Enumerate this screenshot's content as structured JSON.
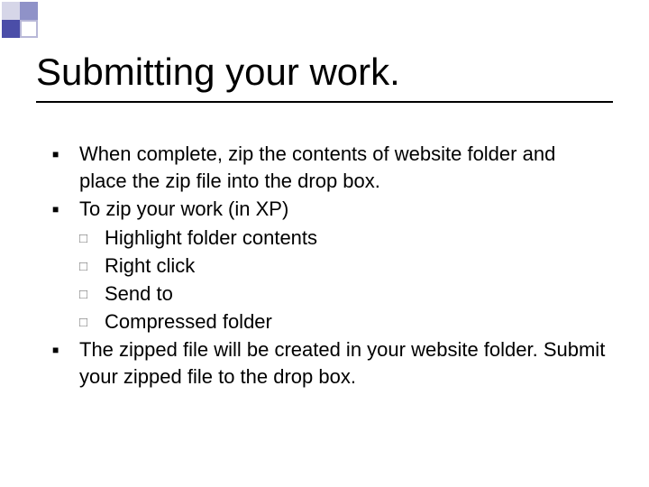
{
  "title": "Submitting your work.",
  "bullets": {
    "b1": "When complete, zip the contents of website folder and place the zip file into the drop box.",
    "b2": "To zip your work (in XP)",
    "b2_sub": {
      "s1": "Highlight folder contents",
      "s2": "Right click",
      "s3": "Send to",
      "s4": "Compressed folder"
    },
    "b3": "The zipped file will be created in your website folder. Submit your zipped file to the drop box."
  }
}
